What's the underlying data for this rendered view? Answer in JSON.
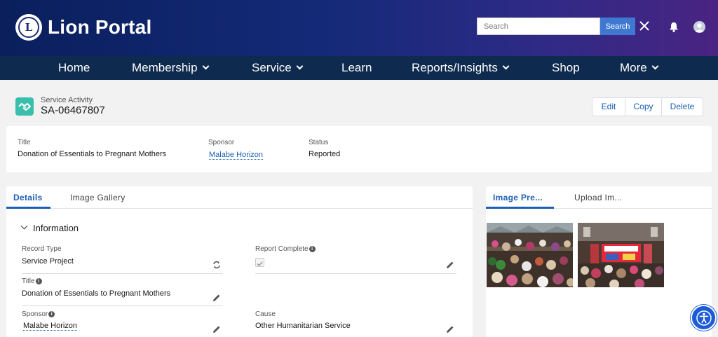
{
  "header": {
    "logo_badge_text": "L",
    "logo_badge_ring_text": "LIONS",
    "app_title": "Lion Portal",
    "search_placeholder": "Search",
    "search_button": "Search"
  },
  "nav": {
    "items": [
      {
        "label": "Home",
        "dropdown": false
      },
      {
        "label": "Membership",
        "dropdown": true
      },
      {
        "label": "Service",
        "dropdown": true
      },
      {
        "label": "Learn",
        "dropdown": false
      },
      {
        "label": "Reports/Insights",
        "dropdown": true
      },
      {
        "label": "Shop",
        "dropdown": false
      },
      {
        "label": "More",
        "dropdown": true
      }
    ]
  },
  "record": {
    "object_type": "Service Activity",
    "record_id": "SA-06467807",
    "actions": [
      "Edit",
      "Copy",
      "Delete"
    ]
  },
  "highlights": {
    "title_label": "Title",
    "title_value": "Donation of Essentials to Pregnant Mothers",
    "sponsor_label": "Sponsor",
    "sponsor_value": "Malabe Horizon",
    "status_label": "Status",
    "status_value": "Reported"
  },
  "details": {
    "tabs": [
      "Details",
      "Image Gallery"
    ],
    "section_title": "Information",
    "record_type_label": "Record Type",
    "record_type_value": "Service Project",
    "report_complete_label": "Report Complete",
    "report_complete_checked": true,
    "title_label": "Title",
    "title_value": "Donation of Essentials to Pregnant Mothers",
    "sponsor_label": "Sponsor",
    "sponsor_value": "Malabe Horizon",
    "cause_label": "Cause",
    "cause_value": "Other Humanitarian Service"
  },
  "gallery": {
    "tabs": [
      "Image Pre...",
      "Upload Im..."
    ]
  },
  "colors": {
    "accent": "#1b5fb5",
    "nav_bg": "#0e2a4f",
    "record_icon": "#3bbfad",
    "search_button": "#3f78d1",
    "a11y_button": "#1d5bd6"
  }
}
